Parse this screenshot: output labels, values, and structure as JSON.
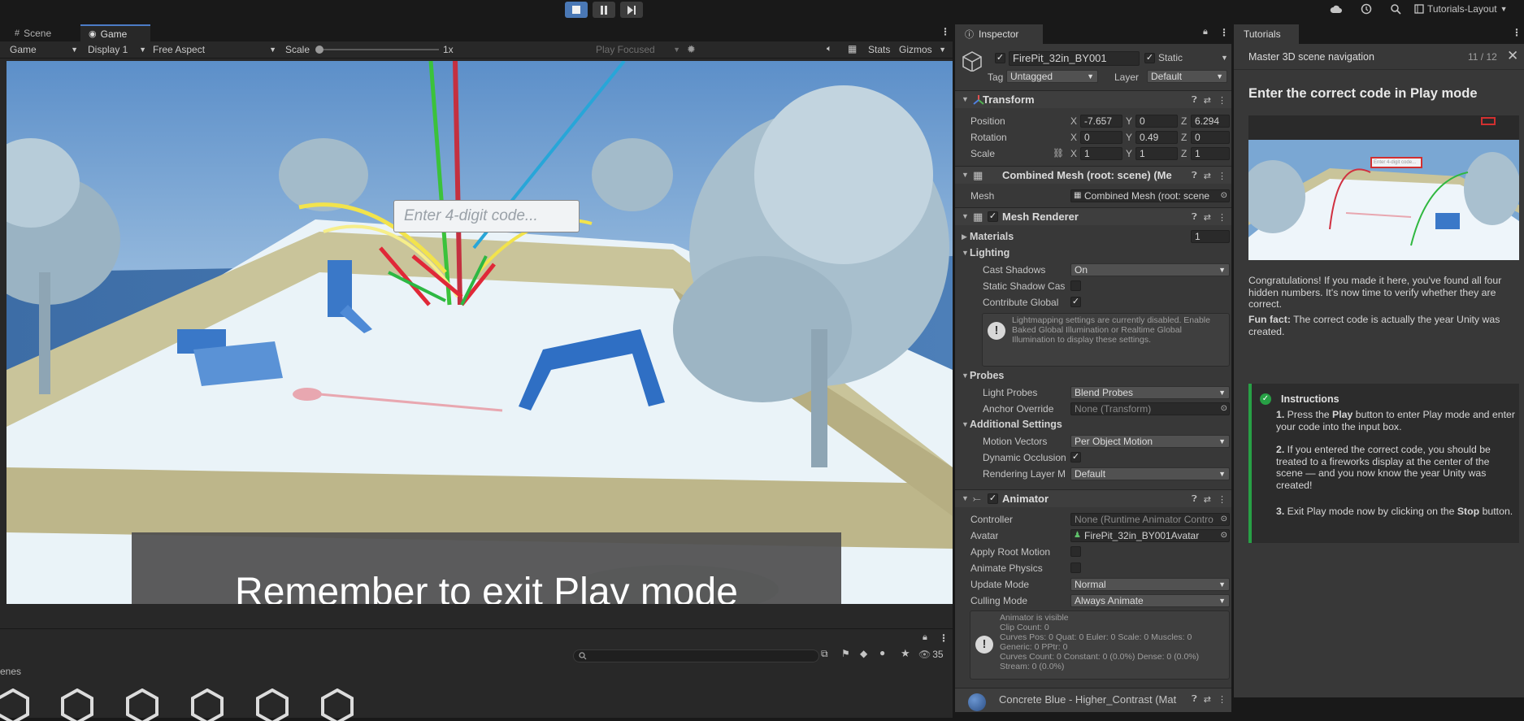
{
  "toolbar": {
    "play_icon": "stop-square-icon",
    "pause_icon": "pause-icon",
    "step_icon": "step-icon",
    "layout_label": "Tutorials-Layout"
  },
  "game_panel": {
    "tabs": [
      {
        "label": "Scene",
        "icon": "scene-grid-icon"
      },
      {
        "label": "Game",
        "icon": "gamepad-icon"
      }
    ],
    "toolbar": {
      "mode": "Game",
      "display": "Display 1",
      "aspect": "Free Aspect",
      "scale_label": "Scale",
      "scale_value": "1x",
      "play_focused": "Play Focused",
      "stats": "Stats",
      "gizmos": "Gizmos"
    },
    "code_placeholder": "Enter 4-digit code...",
    "banner_text": "Remember to exit Play mode"
  },
  "bottom_panel": {
    "title_fragment": "enes",
    "visible_count": "35",
    "search_placeholder": ""
  },
  "inspector": {
    "tab": "Inspector",
    "object_name": "FirePit_32in_BY001",
    "static_label": "Static",
    "tag_label": "Tag",
    "tag_value": "Untagged",
    "layer_label": "Layer",
    "layer_value": "Default",
    "transform": {
      "title": "Transform",
      "position_label": "Position",
      "rotation_label": "Rotation",
      "scale_label": "Scale",
      "position": {
        "x": "-7.657",
        "y": "0",
        "z": "6.294"
      },
      "rotation": {
        "x": "0",
        "y": "0.49",
        "z": "0"
      },
      "scale": {
        "x": "1",
        "y": "1",
        "z": "1"
      }
    },
    "mesh_filter": {
      "title": "Combined Mesh (root: scene) (Me",
      "mesh_label": "Mesh",
      "mesh_value": "Combined Mesh (root: scene"
    },
    "mesh_renderer": {
      "title": "Mesh Renderer",
      "materials_label": "Materials",
      "materials_count": "1",
      "lighting_label": "Lighting",
      "cast_shadows_label": "Cast Shadows",
      "cast_shadows_value": "On",
      "static_shadow_label": "Static Shadow Cas",
      "contribute_gi_label": "Contribute Global",
      "lightmap_warning": "Lightmapping settings are currently disabled. Enable Baked Global Illumination or Realtime Global Illumination to display these settings.",
      "probes_label": "Probes",
      "light_probes_label": "Light Probes",
      "light_probes_value": "Blend Probes",
      "anchor_override_label": "Anchor Override",
      "anchor_override_value": "None (Transform)",
      "additional_label": "Additional Settings",
      "motion_vectors_label": "Motion Vectors",
      "motion_vectors_value": "Per Object Motion",
      "dynamic_occlusion_label": "Dynamic Occlusion",
      "rendering_layer_label": "Rendering Layer M",
      "rendering_layer_value": "Default"
    },
    "animator": {
      "title": "Animator",
      "controller_label": "Controller",
      "controller_value": "None (Runtime Animator Contro",
      "avatar_label": "Avatar",
      "avatar_value": "FirePit_32in_BY001Avatar",
      "apply_root_label": "Apply Root Motion",
      "animate_physics_label": "Animate Physics",
      "update_mode_label": "Update Mode",
      "update_mode_value": "Normal",
      "culling_mode_label": "Culling Mode",
      "culling_mode_value": "Always Animate",
      "info_lines": [
        "Animator is visible",
        "Clip Count: 0",
        "Curves Pos: 0 Quat: 0 Euler: 0 Scale: 0 Muscles: 0",
        "Generic: 0 PPtr: 0",
        "Curves Count: 0 Constant: 0 (0.0%) Dense: 0 (0.0%)",
        "Stream: 0 (0.0%)"
      ]
    },
    "material": {
      "title": "Concrete Blue - Higher_Contrast (Mat"
    }
  },
  "tutorials": {
    "tab": "Tutorials",
    "lesson": "Master 3D scene navigation",
    "progress": "11 / 12",
    "heading": "Enter the correct code in Play mode",
    "thumb_code": "Enter 4-digit code...",
    "congrats": "Congratulations! If you made it here, you've found all four hidden numbers. It's now time to verify whether they are correct.",
    "fun_fact_label": "Fun fact:",
    "fun_fact": " The correct code is actually the year Unity was created.",
    "instructions_title": "Instructions",
    "steps": [
      {
        "n": "1.",
        "pre": " Press the ",
        "bold": "Play",
        "post": " button to enter Play mode and enter your code into the input box."
      },
      {
        "n": "2.",
        "pre": " If you entered the correct code, you should be treated to a fireworks display at the center of the scene — and you now know the year Unity was created!",
        "bold": "",
        "post": ""
      },
      {
        "n": "3.",
        "pre": " Exit Play mode now by clicking on the ",
        "bold": "Stop",
        "post": " button."
      }
    ]
  },
  "colors": {
    "accent": "#4a78b5",
    "success": "#27a045",
    "panel": "#383838"
  }
}
